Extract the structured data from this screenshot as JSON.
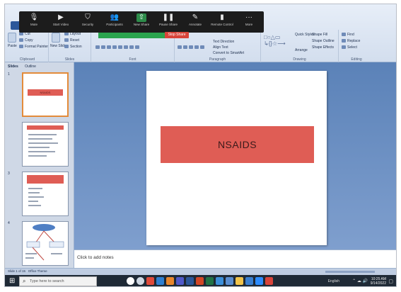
{
  "zoom_toolbar": {
    "items": [
      {
        "label": "Mute",
        "icon": "microphone-icon"
      },
      {
        "label": "Start Video",
        "icon": "video-camera-icon"
      },
      {
        "label": "Security",
        "icon": "shield-icon"
      },
      {
        "label": "Participants",
        "icon": "participants-icon"
      },
      {
        "label": "New Share",
        "icon": "share-screen-icon"
      },
      {
        "label": "Pause Share",
        "icon": "pause-icon"
      },
      {
        "label": "Annotate",
        "icon": "pencil-icon"
      },
      {
        "label": "Remote Control",
        "icon": "remote-control-icon"
      },
      {
        "label": "More",
        "icon": "more-icon"
      }
    ],
    "stop_share_label": "Stop Share"
  },
  "ribbon": {
    "clipboard": {
      "paste": "Paste",
      "cut": "Cut",
      "copy": "Copy",
      "format_painter": "Format Painter",
      "label": "Clipboard"
    },
    "slides": {
      "new_slide": "New Slide",
      "layout": "Layout",
      "reset": "Reset",
      "section": "Section",
      "label": "Slides"
    },
    "font_label": "Font",
    "paragraph": {
      "text_direction": "Text Direction",
      "align_text": "Align Text",
      "convert": "Convert to SmartArt",
      "label": "Paragraph"
    },
    "drawing": {
      "arrange": "Arrange",
      "quick_styles": "Quick Styles",
      "shape_fill": "Shape Fill",
      "shape_outline": "Shape Outline",
      "shape_effects": "Shape Effects",
      "label": "Drawing"
    },
    "editing": {
      "find": "Find",
      "replace": "Replace",
      "select": "Select",
      "label": "Editing"
    }
  },
  "panel": {
    "tabs": [
      "Slides",
      "Outline"
    ],
    "thumbnails": [
      {
        "num": "1",
        "title": "NSAIDS"
      },
      {
        "num": "",
        "title": ""
      },
      {
        "num": "3",
        "title": ""
      },
      {
        "num": "4",
        "title": ""
      }
    ]
  },
  "slide": {
    "title": "NSAIDS",
    "title_color": "#df5d55"
  },
  "notes": {
    "placeholder": "Click to add notes"
  },
  "statusbar": {
    "slide_info": "Slide 1 of 15",
    "theme": "Office Theme"
  },
  "taskbar": {
    "search_placeholder": "Type here to search",
    "icons": [
      {
        "name": "cortana-icon",
        "color": "#ffffff"
      },
      {
        "name": "task-view-icon",
        "color": "#cfd8e3"
      },
      {
        "name": "chrome-icon",
        "color": "#e04a3a"
      },
      {
        "name": "edge-icon",
        "color": "#2f7fd1"
      },
      {
        "name": "firefox-icon",
        "color": "#e8862c"
      },
      {
        "name": "teams-icon",
        "color": "#5059c9"
      },
      {
        "name": "word-icon",
        "color": "#2b579a"
      },
      {
        "name": "powerpoint-icon",
        "color": "#d24726"
      },
      {
        "name": "excel-icon",
        "color": "#217346"
      },
      {
        "name": "edge-browser-icon",
        "color": "#3c8fd9"
      },
      {
        "name": "calculator-icon",
        "color": "#5a8ed1"
      },
      {
        "name": "file-explorer-icon",
        "color": "#f1c34a"
      },
      {
        "name": "store-icon",
        "color": "#3a7fd0"
      },
      {
        "name": "zoom-icon",
        "color": "#2d8cff"
      },
      {
        "name": "app-icon",
        "color": "#d9443a"
      }
    ],
    "language": "English",
    "time": "10:25 AM",
    "date": "9/14/2022"
  }
}
